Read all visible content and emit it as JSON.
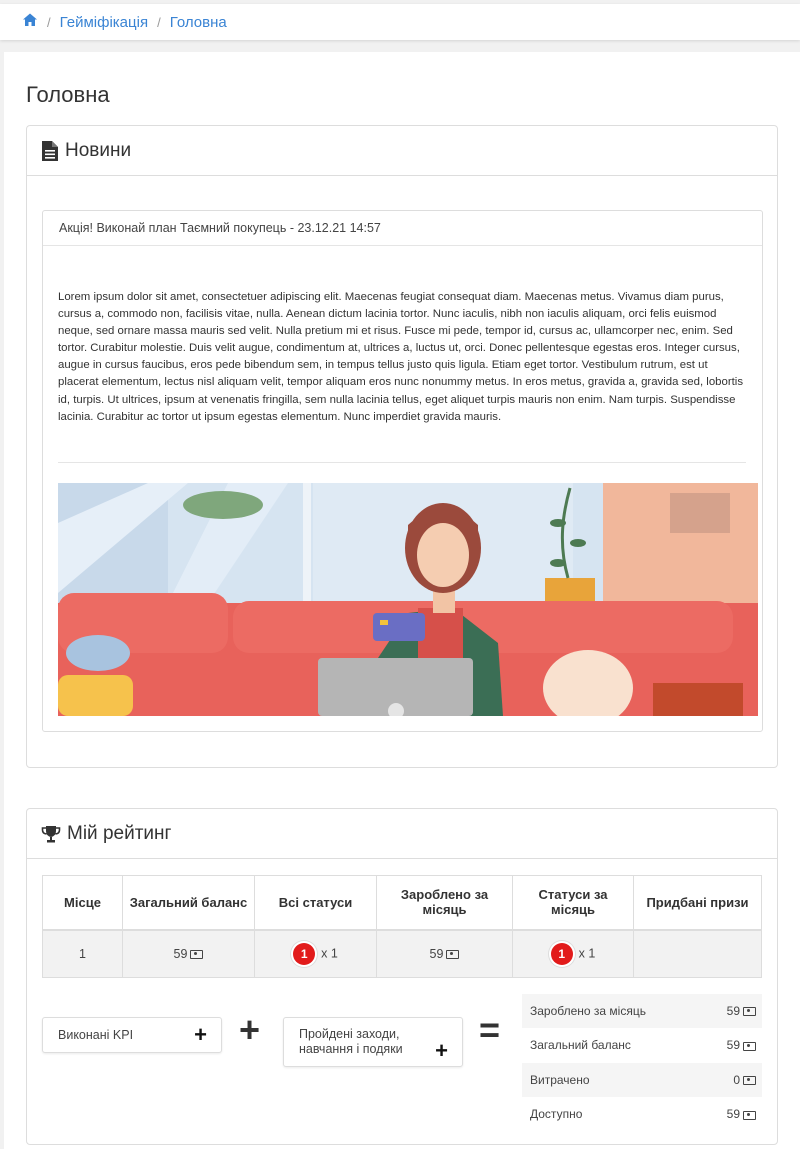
{
  "breadcrumb": {
    "items": [
      "Гейміфікація",
      "Головна"
    ]
  },
  "page": {
    "title": "Головна"
  },
  "news": {
    "header": "Новини",
    "item": {
      "title": "Акція! Виконай план Таємний покупець - 23.12.21 14:57",
      "body": "Lorem ipsum dolor sit amet, consectetuer adipiscing elit. Maecenas feugiat consequat diam. Maecenas metus. Vivamus diam purus, cursus a, commodo non, facilisis vitae, nulla. Aenean dictum lacinia tortor. Nunc iaculis, nibh non iaculis aliquam, orci felis euismod neque, sed ornare massa mauris sed velit. Nulla pretium mi et risus. Fusce mi pede, tempor id, cursus ac, ullamcorper nec, enim. Sed tortor. Curabitur molestie. Duis velit augue, condimentum at, ultrices a, luctus ut, orci. Donec pellentesque egestas eros. Integer cursus, augue in cursus faucibus, eros pede bibendum sem, in tempus tellus justo quis ligula. Etiam eget tortor. Vestibulum rutrum, est ut placerat elementum, lectus nisl aliquam velit, tempor aliquam eros nunc nonummy metus. In eros metus, gravida a, gravida sed, lobortis id, turpis. Ut ultrices, ipsum at venenatis fringilla, sem nulla lacinia tellus, eget aliquet turpis mauris non enim. Nam turpis. Suspendisse lacinia. Curabitur ac tortor ut ipsum egestas elementum. Nunc imperdiet gravida mauris."
    }
  },
  "rating": {
    "header": "Мій рейтинг",
    "columns": [
      "Місце",
      "Загальний баланс",
      "Всі статуси",
      "Зароблено за місяць",
      "Статуси за місяць",
      "Придбані призи"
    ],
    "row": {
      "place": "1",
      "balance": "59",
      "all_status_badge": "1",
      "all_status_count": "x 1",
      "earned": "59",
      "month_status_badge": "1",
      "month_status_count": "x 1",
      "prizes": ""
    },
    "kpi_label": "Виконані KPI",
    "events_label": "Пройдені заходи, навчання і подяки",
    "plus_sign": "+",
    "equals_sign": "=",
    "summary": [
      {
        "label": "Зароблено за місяць",
        "value": "59"
      },
      {
        "label": "Загальний баланс",
        "value": "59"
      },
      {
        "label": "Витрачено",
        "value": "0"
      },
      {
        "label": "Доступно",
        "value": "59"
      }
    ]
  },
  "colors": {
    "link": "#3a84d4",
    "badge": "#e21b1b"
  },
  "icons": [
    "home-icon",
    "file-text-icon",
    "trophy-icon",
    "money-icon",
    "plus-icon"
  ]
}
